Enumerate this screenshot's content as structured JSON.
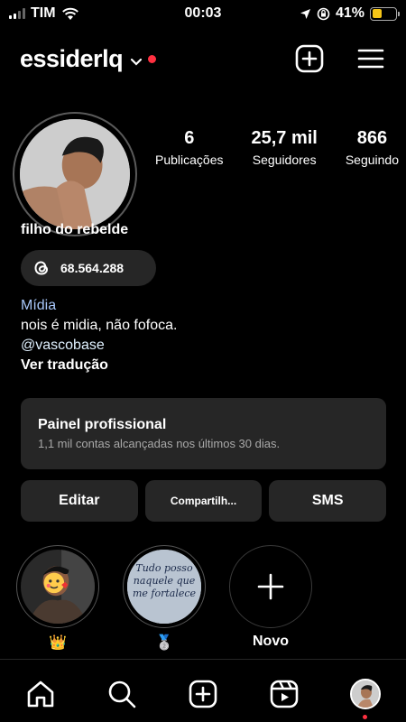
{
  "status_bar": {
    "carrier": "TIM",
    "time": "00:03",
    "battery": "41%",
    "battery_level": 0.41
  },
  "header": {
    "username": "essiderlq",
    "icons": [
      "chevron-down-icon",
      "plus-square-icon",
      "hamburger-menu-icon"
    ]
  },
  "profile": {
    "stats": [
      {
        "value": "6",
        "label": "Publicações"
      },
      {
        "value": "25,7 mil",
        "label": "Seguidores"
      },
      {
        "value": "866",
        "label": "Seguindo"
      }
    ],
    "full_name": "filho do rebelde",
    "threads_count": "68.564.288",
    "bio": {
      "category": "Mídia",
      "text": "nois é midia, não fofoca.",
      "mention": "@vascobase",
      "translate": "Ver tradução"
    }
  },
  "pro_panel": {
    "title": "Painel profissional",
    "subtitle": "1,1 mil contas alcançadas nos últimos 30 dias."
  },
  "actions": [
    "Editar",
    "Compartilh...",
    "SMS"
  ],
  "highlights": [
    {
      "label": "👑"
    },
    {
      "label": "🥈",
      "cover_text": "Tudo posso naquele que me fortalece"
    },
    {
      "label": "Novo"
    }
  ],
  "tab_bar": [
    "home-icon",
    "search-icon",
    "create-icon",
    "reels-icon",
    "profile-avatar"
  ],
  "colors": {
    "background": "#000000",
    "surface": "#262626",
    "accent_red": "#ff3040",
    "battery": "#f5c518"
  }
}
